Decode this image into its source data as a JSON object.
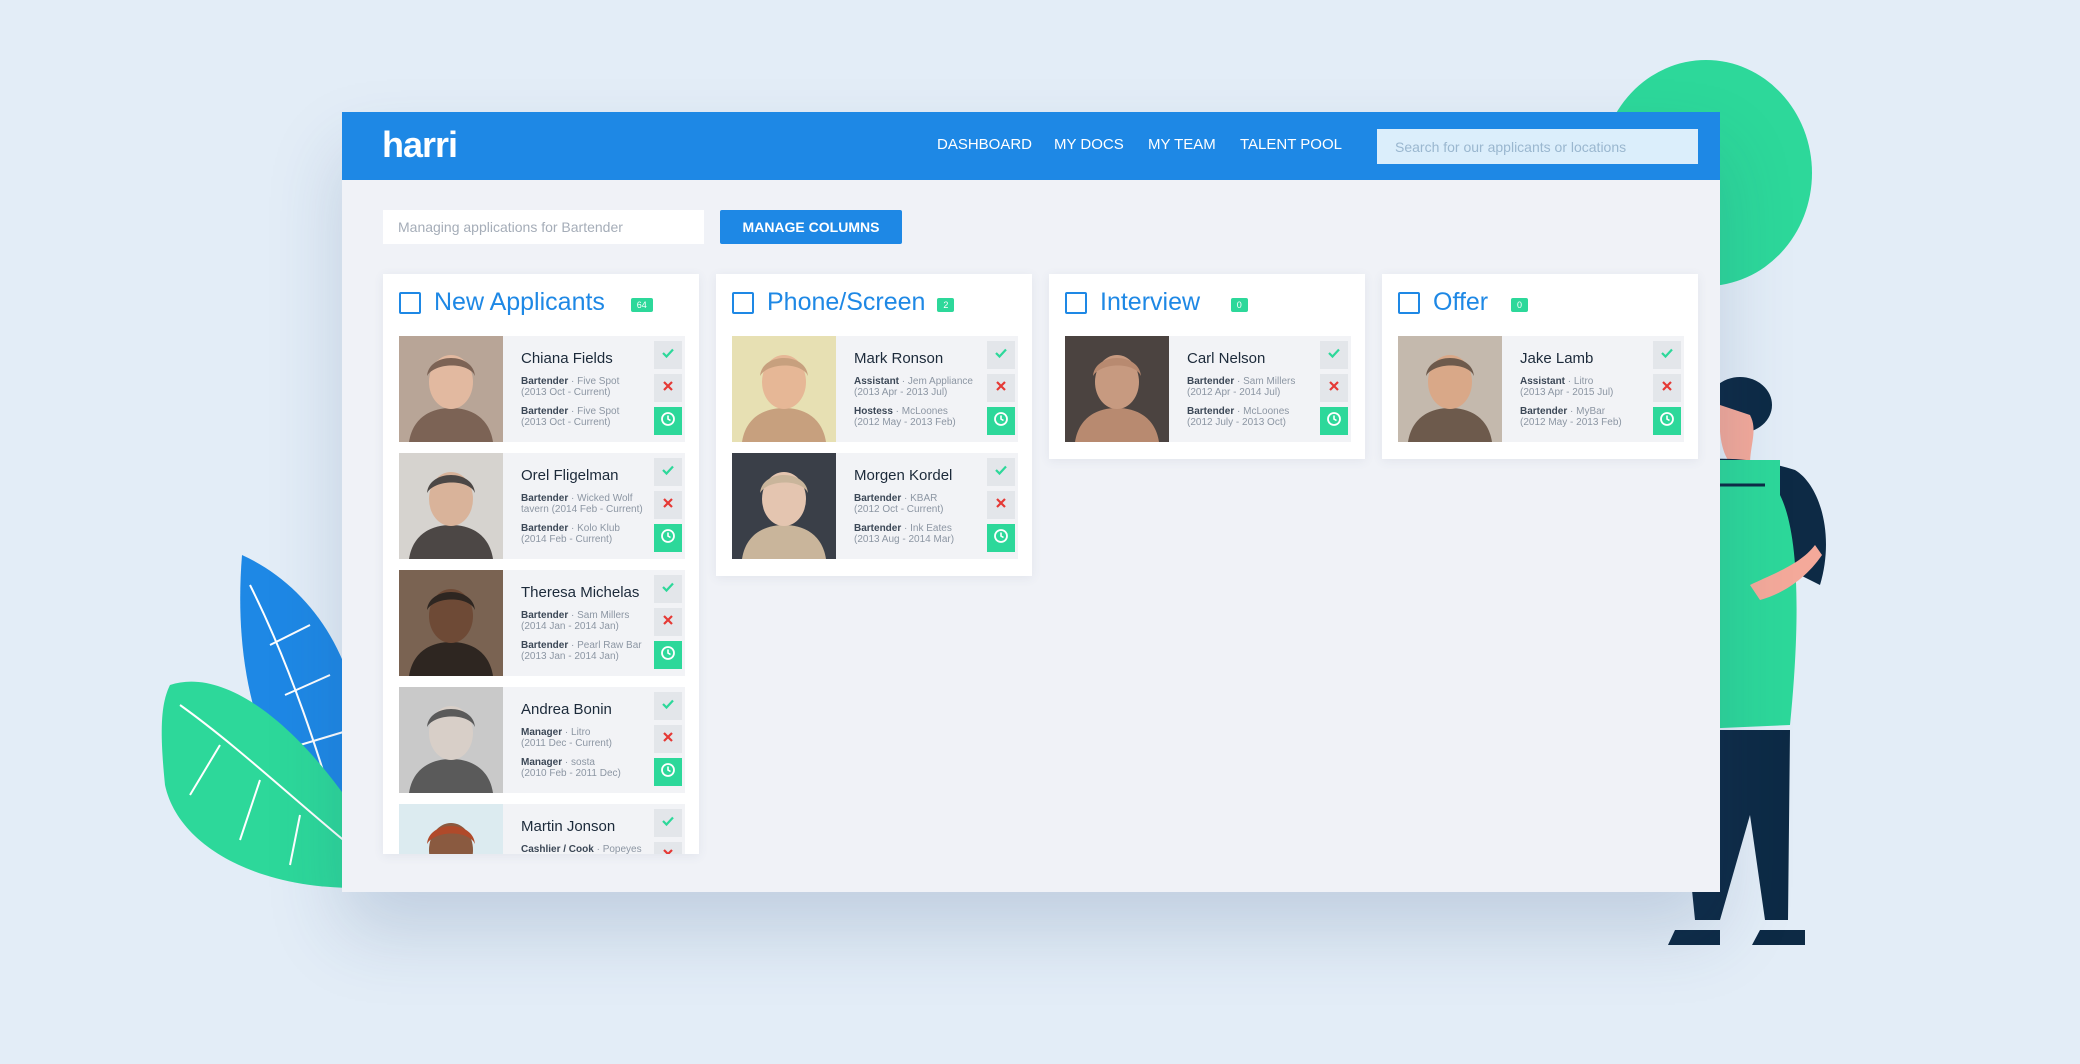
{
  "app": {
    "logo_text": "harri"
  },
  "nav": {
    "items": [
      "DASHBOARD",
      "MY DOCS",
      "MY TEAM",
      "TALENT POOL"
    ]
  },
  "search": {
    "placeholder": "Search for our applicants or locations"
  },
  "toolbar": {
    "job_placeholder": "Managing applications for Bartender",
    "manage_columns_label": "MANAGE COLUMNS"
  },
  "colors": {
    "brand_blue": "#1e88e5",
    "accent_green": "#2dd89a",
    "reject_red": "#e53935"
  },
  "columns": [
    {
      "title": "New Applicants",
      "count": "64",
      "cards": [
        {
          "name": "Chiana Fields",
          "exp": [
            {
              "role": "Bartender",
              "place": " · Five Spot",
              "dates": "(2013 Oct - Current)"
            },
            {
              "role": "Bartender",
              "place": " · Five Spot",
              "dates": "(2013 Oct - Current)"
            }
          ]
        },
        {
          "name": "Orel Fligelman",
          "exp": [
            {
              "role": "Bartender",
              "place": " · Wicked Wolf",
              "dates": "tavern (2014 Feb - Current)"
            },
            {
              "role": "Bartender",
              "place": " · Kolo Klub",
              "dates": "(2014 Feb - Current)"
            }
          ]
        },
        {
          "name": "Theresa Michelas",
          "exp": [
            {
              "role": "Bartender",
              "place": " · Sam Millers",
              "dates": "(2014 Jan - 2014 Jan)"
            },
            {
              "role": "Bartender",
              "place": " · Pearl Raw Bar",
              "dates": "(2013 Jan - 2014 Jan)"
            }
          ]
        },
        {
          "name": "Andrea Bonin",
          "exp": [
            {
              "role": "Manager",
              "place": " · Litro",
              "dates": "(2011 Dec - Current)"
            },
            {
              "role": "Manager",
              "place": " · sosta",
              "dates": "(2010 Feb - 2011 Dec)"
            }
          ]
        },
        {
          "name": "Martin Jonson",
          "exp": [
            {
              "role": "Cashlier / Cook",
              "place": " · Popeyes",
              "dates": ""
            }
          ]
        }
      ]
    },
    {
      "title": "Phone/Screen",
      "count": "2",
      "cards": [
        {
          "name": "Mark Ronson",
          "exp": [
            {
              "role": "Assistant",
              "place": " · Jem Appliance",
              "dates": "(2013 Apr - 2013 Jul)"
            },
            {
              "role": "Hostess",
              "place": " · McLoones",
              "dates": "(2012 May - 2013 Feb)"
            }
          ]
        },
        {
          "name": "Morgen Kordel",
          "exp": [
            {
              "role": "Bartender",
              "place": " · KBAR",
              "dates": "(2012 Oct - Current)"
            },
            {
              "role": "Bartender",
              "place": " · Ink Eates",
              "dates": "(2013 Aug - 2014 Mar)"
            }
          ]
        }
      ]
    },
    {
      "title": "Interview",
      "count": "0",
      "cards": [
        {
          "name": "Carl Nelson",
          "exp": [
            {
              "role": "Bartender",
              "place": " · Sam Millers",
              "dates": "(2012 Apr - 2014 Jul)"
            },
            {
              "role": "Bartender",
              "place": " · McLoones",
              "dates": "(2012 July - 2013 Oct)"
            }
          ]
        }
      ]
    },
    {
      "title": "Offer",
      "count": "0",
      "cards": [
        {
          "name": "Jake Lamb",
          "exp": [
            {
              "role": "Assistant",
              "place": " · Litro",
              "dates": "(2013 Apr - 2015 Jul)"
            },
            {
              "role": "Bartender",
              "place": " · MyBar",
              "dates": "(2012 May - 2013 Feb)"
            }
          ]
        }
      ]
    }
  ]
}
